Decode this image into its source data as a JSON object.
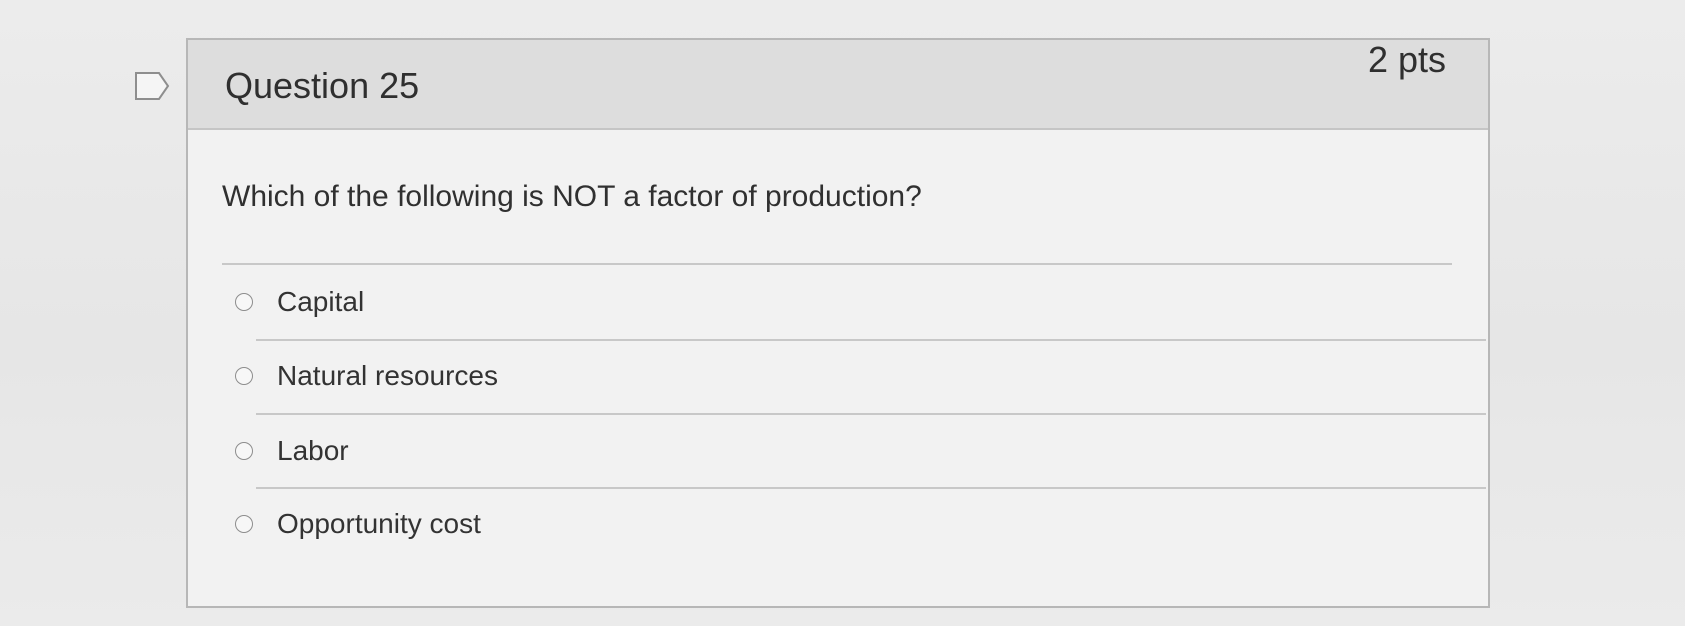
{
  "question": {
    "title": "Question 25",
    "points": "2 pts",
    "prompt": "Which of the following is NOT a factor of production?",
    "options": [
      {
        "label": "Capital"
      },
      {
        "label": "Natural resources"
      },
      {
        "label": "Labor"
      },
      {
        "label": "Opportunity cost"
      }
    ],
    "flag_icon": "bookmark-flag-icon"
  }
}
